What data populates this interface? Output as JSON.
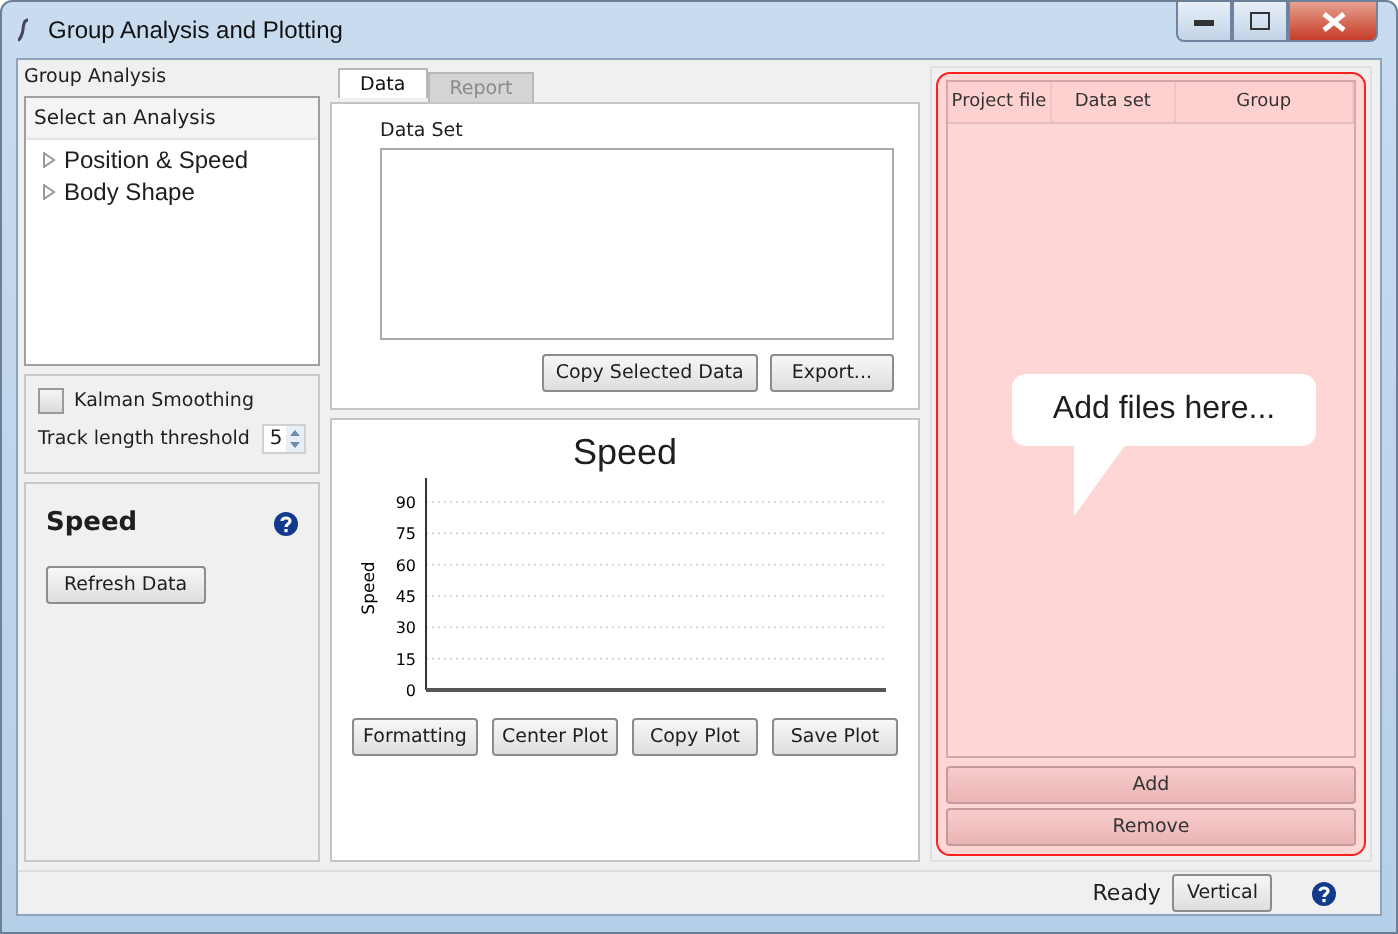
{
  "window": {
    "title": "Group Analysis and Plotting"
  },
  "group_analysis": {
    "title": "Group Analysis",
    "list_header": "Select an Analysis",
    "items": [
      {
        "label": "Position & Speed",
        "expanded": false
      },
      {
        "label": "Body Shape",
        "expanded": false
      }
    ]
  },
  "options": {
    "kalman": {
      "label": "Kalman Smoothing",
      "checked": false
    },
    "threshold": {
      "label": "Track length threshold",
      "value": "5"
    }
  },
  "speed_panel": {
    "title": "Speed",
    "refresh_button": "Refresh Data"
  },
  "tabs": [
    {
      "label": "Data",
      "selected": true
    },
    {
      "label": "Report",
      "selected": false
    }
  ],
  "data_set": {
    "label": "Data Set",
    "buttons": [
      "Copy Selected Data",
      "Export..."
    ]
  },
  "plot": {
    "title": "Speed",
    "y_axis_label": "Speed",
    "y_axis_ticks": [
      "90",
      "75",
      "60",
      "45",
      "30",
      "15",
      "0"
    ],
    "buttons": [
      "Formatting",
      "Center Plot",
      "Copy Plot",
      "Save Plot"
    ]
  },
  "files": {
    "columns": [
      "Project file",
      "Data set",
      "Group"
    ],
    "callout": "Add files here...",
    "buttons": [
      "Add",
      "Remove"
    ]
  },
  "status_bar": {
    "status": "Ready",
    "layout_button": "Vertical"
  }
}
